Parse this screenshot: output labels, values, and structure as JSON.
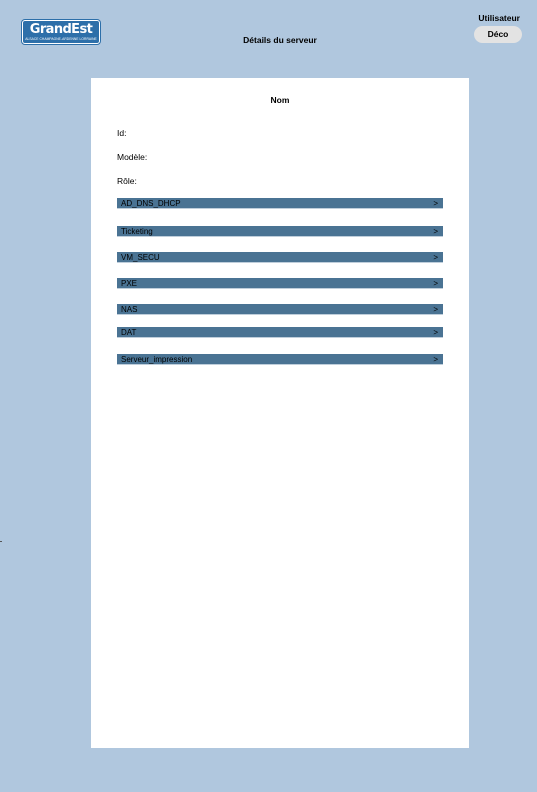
{
  "header": {
    "logo": {
      "brand": "GrandEst",
      "subtitle": "ALSACE CHAMPAGNE-ARDENNE LORRAINE"
    },
    "title": "Détails du serveur",
    "user_label": "Utilisateur",
    "logout_label": "Déco"
  },
  "card": {
    "title": "Nom",
    "fields": {
      "id": "Id:",
      "model": "Modèle:",
      "role": "Rôle:"
    },
    "roles": [
      {
        "label": "AD_DNS_DHCP",
        "chevron": ">"
      },
      {
        "label": "Ticketing",
        "chevron": ">"
      },
      {
        "label": "VM_SECU",
        "chevron": ">"
      },
      {
        "label": "PXE",
        "chevron": ">"
      },
      {
        "label": "NAS",
        "chevron": ">"
      },
      {
        "label": "DAT",
        "chevron": ">"
      },
      {
        "label": "Serveur_impression",
        "chevron": ">"
      }
    ]
  },
  "colors": {
    "background": "#b0c7de",
    "role_bar": "#4a7393",
    "logo": "#2d6fa9",
    "button": "#e3e3e3"
  }
}
